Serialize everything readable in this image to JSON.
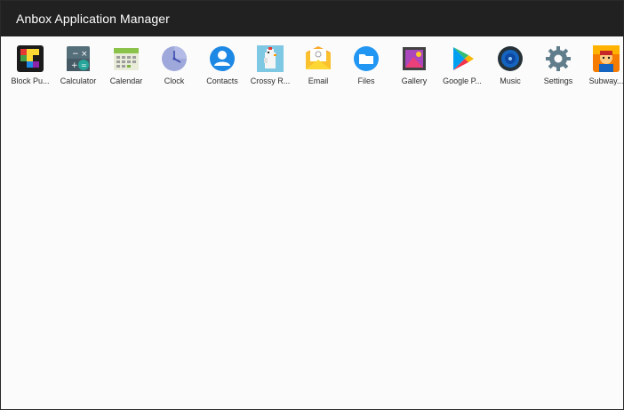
{
  "window": {
    "title": "Anbox Application Manager"
  },
  "apps": [
    {
      "label": "Block Pu...",
      "icon": "block-puzzle-icon"
    },
    {
      "label": "Calculator",
      "icon": "calculator-icon"
    },
    {
      "label": "Calendar",
      "icon": "calendar-icon"
    },
    {
      "label": "Clock",
      "icon": "clock-icon"
    },
    {
      "label": "Contacts",
      "icon": "contacts-icon"
    },
    {
      "label": "Crossy R...",
      "icon": "crossy-road-icon"
    },
    {
      "label": "Email",
      "icon": "email-icon"
    },
    {
      "label": "Files",
      "icon": "files-icon"
    },
    {
      "label": "Gallery",
      "icon": "gallery-icon"
    },
    {
      "label": "Google P...",
      "icon": "google-play-icon"
    },
    {
      "label": "Music",
      "icon": "music-icon"
    },
    {
      "label": "Settings",
      "icon": "settings-icon"
    },
    {
      "label": "Subway...",
      "icon": "subway-surfers-icon"
    }
  ],
  "colors": {
    "titlebar": "#212121",
    "background": "#fbfbfb"
  }
}
